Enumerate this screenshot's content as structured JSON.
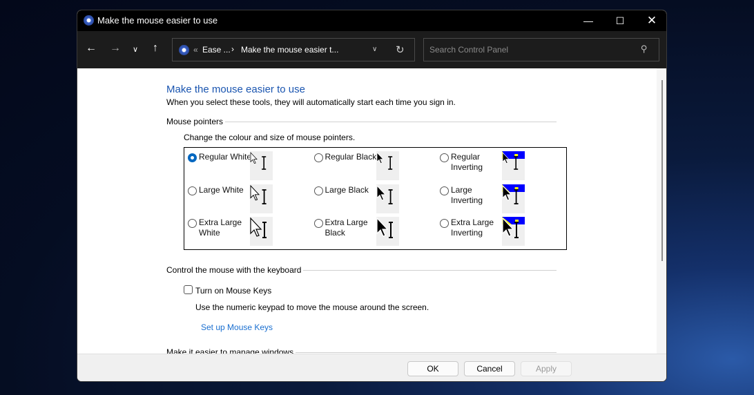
{
  "window": {
    "title": "Make the mouse easier to use",
    "controls": [
      "minimize",
      "maximize",
      "close"
    ]
  },
  "toolbar": {
    "breadcrumb": [
      "Ease ...",
      "Make the mouse easier t..."
    ],
    "breadcrumb_prefix": "«",
    "search_placeholder": "Search Control Panel"
  },
  "page": {
    "title": "Make the mouse easier to use",
    "subtitle": "When you select these tools, they will automatically start each time you sign in."
  },
  "mouse_pointers": {
    "heading": "Mouse pointers",
    "description": "Change the colour and size of mouse pointers.",
    "options": [
      {
        "label": "Regular White",
        "scheme": "white",
        "size": "regular",
        "selected": true
      },
      {
        "label": "Regular Black",
        "scheme": "black",
        "size": "regular",
        "selected": false
      },
      {
        "label": "Regular Inverting",
        "scheme": "inverting",
        "size": "regular",
        "selected": false
      },
      {
        "label": "Large White",
        "scheme": "white",
        "size": "large",
        "selected": false
      },
      {
        "label": "Large Black",
        "scheme": "black",
        "size": "large",
        "selected": false
      },
      {
        "label": "Large Inverting",
        "scheme": "inverting",
        "size": "large",
        "selected": false
      },
      {
        "label": "Extra Large White",
        "scheme": "white",
        "size": "xlarge",
        "selected": false
      },
      {
        "label": "Extra Large Black",
        "scheme": "black",
        "size": "xlarge",
        "selected": false
      },
      {
        "label": "Extra Large Inverting",
        "scheme": "inverting",
        "size": "xlarge",
        "selected": false
      }
    ]
  },
  "keyboard": {
    "heading": "Control the mouse with the keyboard",
    "checkbox_label": "Turn on Mouse Keys",
    "checked": false,
    "description": "Use the numeric keypad to move the mouse around the screen.",
    "link": "Set up Mouse Keys"
  },
  "windows": {
    "heading": "Make it easier to manage windows"
  },
  "footer": {
    "ok": "OK",
    "cancel": "Cancel",
    "apply": "Apply",
    "apply_enabled": false
  },
  "colors": {
    "accent": "#0067c0",
    "link": "#1a6fd0",
    "title": "#1a55b0"
  }
}
